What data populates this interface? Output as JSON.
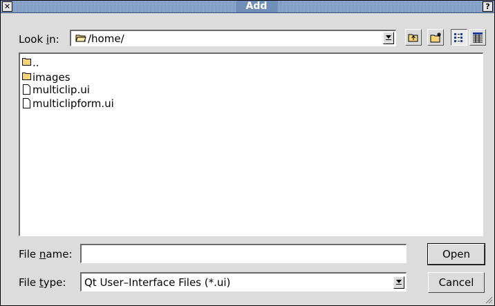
{
  "window": {
    "title": "Add",
    "close_symbol": "✕",
    "help_symbol": "?"
  },
  "toolbar": {
    "look_in_prefix": "Look ",
    "look_in_mnemonic": "i",
    "look_in_suffix": "n:",
    "path": "/home/"
  },
  "files": [
    {
      "name": "..",
      "icon": "folder-icon"
    },
    {
      "name": "images",
      "icon": "folder-icon"
    },
    {
      "name": "multiclip.ui",
      "icon": "file-icon"
    },
    {
      "name": "multiclipform.ui",
      "icon": "file-icon"
    }
  ],
  "file_name": {
    "prefix": "File ",
    "mnemonic": "n",
    "suffix": "ame:",
    "value": ""
  },
  "file_type": {
    "prefix": "File ",
    "mnemonic": "t",
    "suffix": "ype:",
    "value": "Qt User–Interface Files (*.ui)"
  },
  "buttons": {
    "open": "Open",
    "cancel": "Cancel"
  }
}
